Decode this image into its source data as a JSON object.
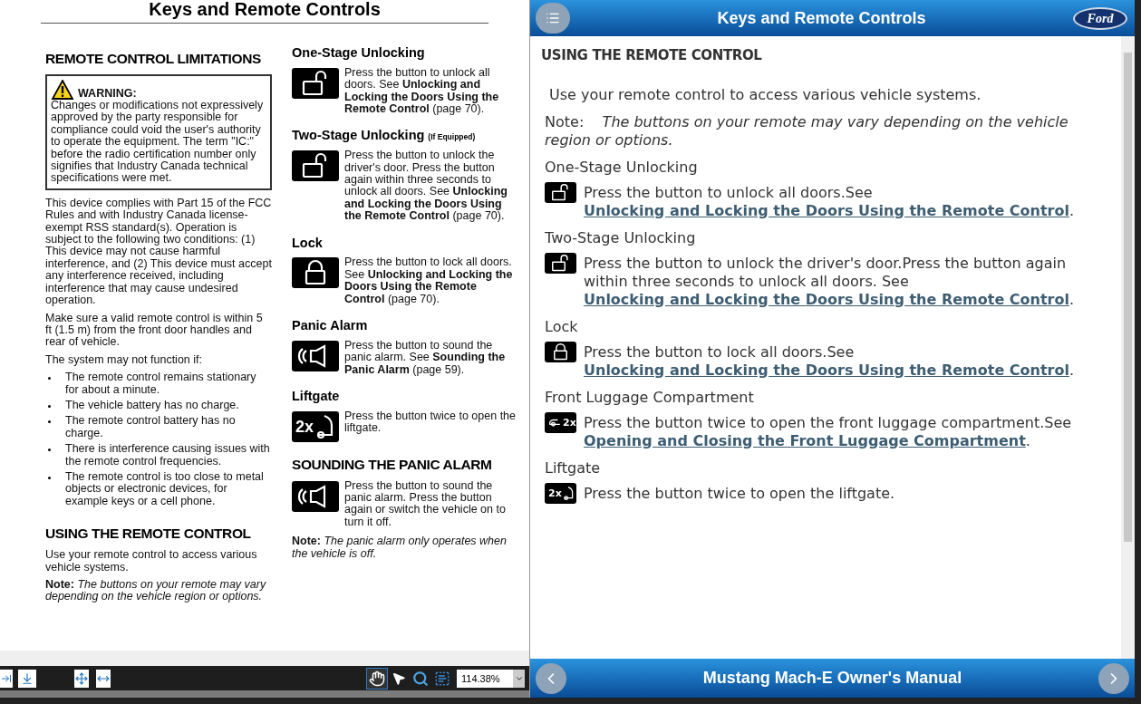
{
  "pdf": {
    "title": "Keys and Remote Controls",
    "columns": [
      [
        {
          "kind": "heading",
          "text": "REMOTE CONTROL LIMITATIONS"
        },
        {
          "kind": "warning",
          "label": "WARNING:",
          "text": "Changes or modifications not expressively approved by the party responsible for compliance could void the user's authority to operate the equipment. The term \"IC:\" before the radio certification number only signifies that Industry Canada technical specifications were met."
        },
        {
          "kind": "paragraph",
          "text": "This device complies with Part 15 of the FCC Rules and with Industry Canada license-exempt RSS standard(s). Operation is subject to the following two conditions: (1) This device may not cause harmful interference, and (2) This device must accept any interference received, including interference that may cause undesired operation."
        },
        {
          "kind": "paragraph",
          "text": "Make sure a valid remote control is within 5 ft (1.5 m) from the front door handles and rear of vehicle."
        },
        {
          "kind": "paragraph",
          "text": "The system may not function if:"
        },
        {
          "kind": "bullets",
          "items": [
            "The remote control remains stationary for about a minute.",
            "The vehicle battery has no charge.",
            "The remote control battery has no charge.",
            "There is interference causing issues with the remote control frequencies.",
            "The remote control is too close to metal objects or electronic devices, for example keys or a cell phone."
          ]
        },
        {
          "kind": "heading",
          "text": "USING THE REMOTE CONTROL"
        },
        {
          "kind": "paragraph",
          "text": "Use your remote control to access various vehicle systems."
        },
        {
          "kind": "note",
          "label": "Note:",
          "text": "The buttons on your remote may vary depending on the vehicle region or options."
        }
      ],
      [
        {
          "kind": "subheading",
          "text": "One-Stage Unlocking"
        },
        {
          "kind": "unlock",
          "text": "Press the button to unlock all doors.  See **Unlocking and Locking the Doors Using the Remote Control** (page 70)."
        },
        {
          "kind": "subheading",
          "text": "Two-Stage Unlocking",
          "suffix": "(If Equipped)"
        },
        {
          "kind": "unlock",
          "text": "Press the button to unlock the driver's door.  Press the button again within three seconds to unlock all doors.  See **Unlocking and Locking the Doors Using the Remote Control** (page 70)."
        },
        {
          "kind": "subheading",
          "text": "Lock"
        },
        {
          "kind": "lock",
          "text": "Press the button to lock all doors.  See **Unlocking and Locking the Doors Using the Remote Control** (page 70)."
        },
        {
          "kind": "subheading",
          "text": "Panic Alarm"
        },
        {
          "kind": "panic",
          "text": "Press the button to sound the panic alarm.  See **Sounding the Panic Alarm** (page 59)."
        },
        {
          "kind": "subheading",
          "text": "Liftgate"
        },
        {
          "kind": "liftgate",
          "icon_text": "2x",
          "text": "Press the button twice to open the liftgate."
        },
        {
          "kind": "heading",
          "text": "SOUNDING THE PANIC ALARM"
        },
        {
          "kind": "panic",
          "text": "Press the button to sound the panic alarm.  Press the button again or switch the vehicle on to turn it off."
        },
        {
          "kind": "note",
          "label": "Note:",
          "text": "The panic alarm only operates when the vehicle is off."
        }
      ]
    ],
    "toolbar": {
      "tools": [
        {
          "kind": "hand",
          "selected": true
        },
        {
          "kind": "pointer",
          "selected": false
        },
        {
          "kind": "zoom",
          "selected": false
        },
        {
          "kind": "text",
          "selected": false
        }
      ],
      "zoom": "114.38%"
    }
  },
  "app": {
    "title": "Keys and Remote Controls",
    "logo_text": "Ford",
    "section_title": "USING THE REMOTE CONTROL",
    "intro": "Use your remote control to access various vehicle systems.",
    "note": {
      "label": "Note:",
      "text": "The buttons on your remote may vary depending on the vehicle region or options."
    },
    "items": [
      {
        "heading": "One-Stage Unlocking",
        "kind": "unlock",
        "text": "Press the button to unlock all doors.See",
        "link": "Unlocking and Locking the Doors Using the Remote Control",
        "after": "."
      },
      {
        "heading": "Two-Stage Unlocking",
        "kind": "unlock",
        "text": "Press the button to unlock the driver's door.Press the button again within three seconds to unlock all doors.  See",
        "link": "Unlocking and Locking the Doors Using the Remote Control",
        "after": "."
      },
      {
        "heading": "Lock",
        "kind": "lock",
        "text": "Press the button to lock all doors.See",
        "link": "Unlocking and Locking the Doors Using the Remote Control",
        "after": "."
      },
      {
        "heading": "Front Luggage Compartment",
        "kind": "luggage",
        "icon_text": "2x",
        "text": "Press the button twice to open the front luggage compartment.See",
        "link": "Opening and Closing the Front Luggage Compartment",
        "after": "."
      },
      {
        "heading": "Liftgate",
        "kind": "liftgate",
        "icon_text": "2x",
        "text": "Press the button twice to open the liftgate."
      }
    ],
    "footer": {
      "title": "Mustang Mach-E Owner's Manual"
    }
  }
}
